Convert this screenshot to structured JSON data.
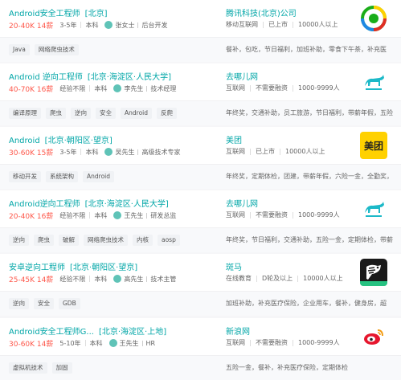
{
  "jobs": [
    {
      "title": "Android安全工程师",
      "location": "[北京]",
      "salary": "20-40K 14薪",
      "experience": "3-5年",
      "education": "本科",
      "recruiter_name": "张女士",
      "recruiter_role": "后台开发",
      "company": "腾讯科技(北京)公司",
      "company_meta": [
        "移动互联网",
        "已上市",
        "10000人以上"
      ],
      "tags": [
        "Java",
        "网络爬虫技术"
      ],
      "welfare": "餐补，包吃，节日福利，加班补助，零食下午茶，补充医"
    },
    {
      "title": "Android 逆向工程师",
      "location": "[北京·海淀区·人民大学]",
      "salary": "40-70K 16薪",
      "experience": "经验不限",
      "education": "本科",
      "recruiter_name": "李先生",
      "recruiter_role": "技术经理",
      "company": "去哪儿网",
      "company_meta": [
        "互联网",
        "不需要融资",
        "1000-9999人"
      ],
      "tags": [
        "编译原理",
        "爬虫",
        "逆向",
        "安全",
        "Android",
        "反爬"
      ],
      "welfare": "年终奖，交通补助，员工旅游，节日福利，带薪年假，五险"
    },
    {
      "title": "Android",
      "location": "[北京·朝阳区·望京]",
      "salary": "30-60K 15薪",
      "experience": "3-5年",
      "education": "本科",
      "recruiter_name": "吴先生",
      "recruiter_role": "高级技术专家",
      "company": "美团",
      "company_meta": [
        "互联网",
        "已上市",
        "10000人以上"
      ],
      "tags": [
        "移动开发",
        "系统架构",
        "Android"
      ],
      "welfare": "年终奖，定期体检，团建，带薪年假，六险一金，全勤奖，"
    },
    {
      "title": "Android逆向工程师",
      "location": "[北京·海淀区·人民大学]",
      "salary": "20-40K 16薪",
      "experience": "经验不限",
      "education": "本科",
      "recruiter_name": "王先生",
      "recruiter_role": "研发总监",
      "company": "去哪儿网",
      "company_meta": [
        "互联网",
        "不需要融资",
        "1000-9999人"
      ],
      "tags": [
        "逆向",
        "爬虫",
        "破解",
        "网络爬虫技术",
        "内核",
        "aosp"
      ],
      "welfare": "年终奖，节日福利，交通补助，五险一金，定期体检，带薪"
    },
    {
      "title": "安卓逆向工程师",
      "location": "[北京·朝阳区·望京]",
      "salary": "25-45K 14薪",
      "experience": "经验不限",
      "education": "本科",
      "recruiter_name": "高先生",
      "recruiter_role": "技术主管",
      "company": "斑马",
      "company_meta": [
        "在线教育",
        "D轮及以上",
        "10000人以上"
      ],
      "tags": [
        "逆向",
        "安全",
        "GDB"
      ],
      "welfare": "加班补助，补充医疗保险，企业用车，餐补，健身房，超"
    },
    {
      "title": "Android安全工程师G...",
      "location": "[北京·海淀区·上地]",
      "salary": "30-60K 14薪",
      "experience": "5-10年",
      "education": "本科",
      "recruiter_name": "王先生",
      "recruiter_role": "HR",
      "company": "新浪网",
      "company_meta": [
        "互联网",
        "不需要融资",
        "1000-9999人"
      ],
      "tags": [
        "虚拟机技术",
        "加固"
      ],
      "welfare": "五险一金，餐补，补充医疗保险，定期体检"
    }
  ],
  "logos": [
    "tencent-logo",
    "qunar-logo",
    "meituan-logo",
    "qunar-logo",
    "zebra-logo",
    "sina-logo"
  ],
  "logo_text": {
    "meituan": "美团"
  },
  "colors": {
    "accent": "#00a6a7",
    "salary": "#fe574a",
    "meituan_bg": "#ffd100"
  }
}
